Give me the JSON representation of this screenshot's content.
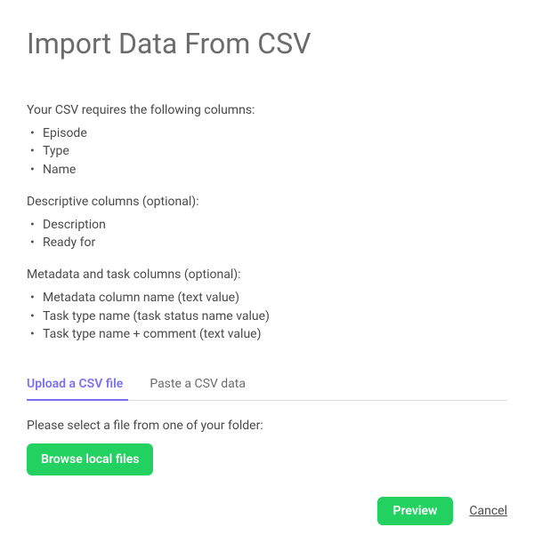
{
  "title": "Import Data From CSV",
  "required": {
    "intro": "Your CSV requires the following columns:",
    "items": [
      "Episode",
      "Type",
      "Name"
    ]
  },
  "descriptive": {
    "intro": "Descriptive columns (optional):",
    "items": [
      "Description",
      "Ready for"
    ]
  },
  "metadata": {
    "intro": "Metadata and task columns (optional):",
    "items": [
      "Metadata column name (text value)",
      "Task type name (task status name value)",
      "Task type name + comment (text value)"
    ]
  },
  "tabs": {
    "upload": "Upload a CSV file",
    "paste": "Paste a CSV data"
  },
  "instruction": "Please select a file from one of your folder:",
  "buttons": {
    "browse": "Browse local files",
    "preview": "Preview",
    "cancel": "Cancel"
  }
}
